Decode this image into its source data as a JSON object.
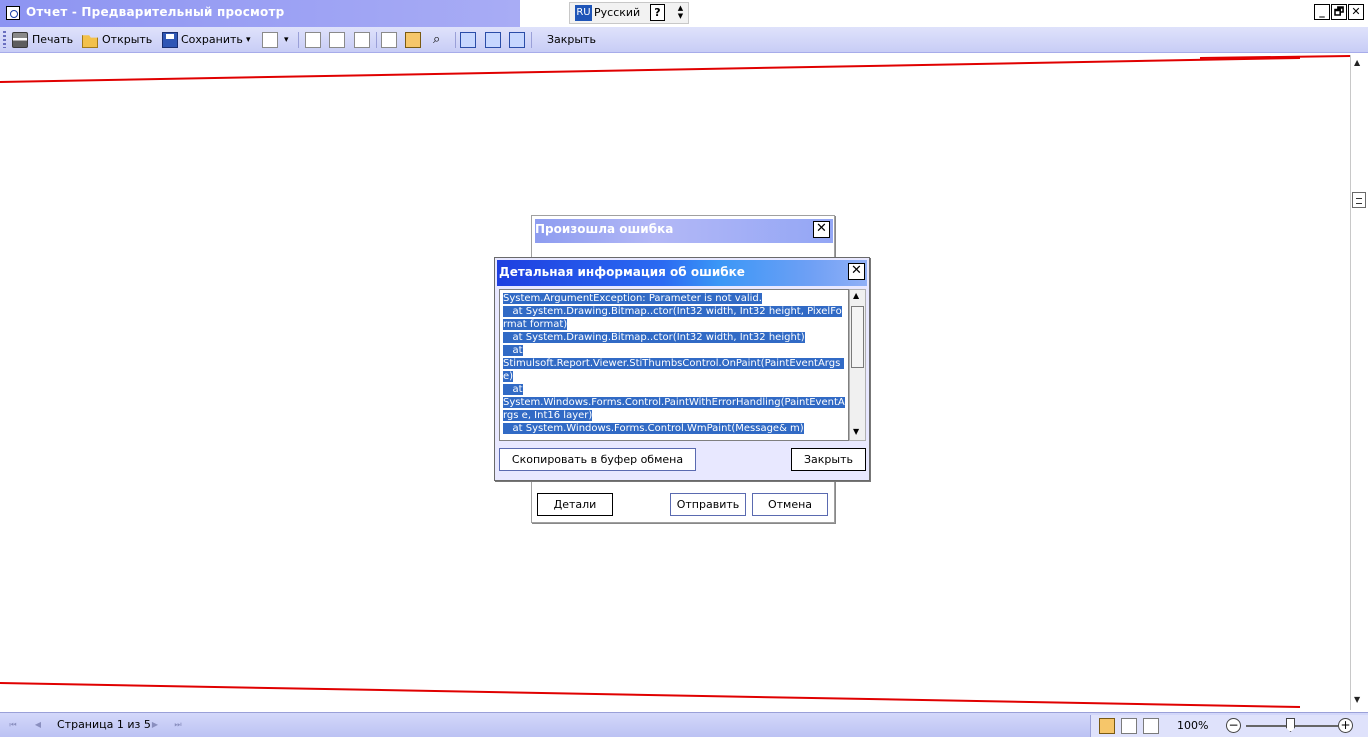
{
  "window": {
    "title": "Отчет - Предварительный просмотр",
    "language_code": "RU",
    "language_name": "Русский",
    "help_glyph": "?",
    "controls": {
      "minimize": "_",
      "restore": "🗗",
      "close": "✕"
    }
  },
  "toolbar": {
    "print_label": "Печать",
    "open_label": "Открыть",
    "save_label": "Сохранить",
    "close_label": "Закрыть",
    "dropdown_glyph": "▾"
  },
  "statusbar": {
    "page_text": "Страница 1 из 5",
    "zoom": "100%",
    "nav_first": "⏮",
    "nav_prev": "◀",
    "nav_next": "▶",
    "nav_last": "⏭"
  },
  "error_dialog": {
    "title": "Произошла ошибка",
    "close_glyph": "✕",
    "details_label": "Детали",
    "send_label": "Отправить",
    "cancel_label": "Отмена"
  },
  "details_dialog": {
    "title": "Детальная информация об ошибке",
    "close_glyph": "✕",
    "lines": [
      "System.ArgumentException: Parameter is not valid.",
      "   at System.Drawing.Bitmap..ctor(Int32 width, Int32 height, PixelFormat format)",
      "   at System.Drawing.Bitmap..ctor(Int32 width, Int32 height)",
      "   at",
      "Stimulsoft.Report.Viewer.StiThumbsControl.OnPaint(PaintEventArgs e)",
      "   at",
      "System.Windows.Forms.Control.PaintWithErrorHandling(PaintEventArgs e, Int16 layer)",
      "   at System.Windows.Forms.Control.WmPaint(Message& m)"
    ],
    "copy_label": "Скопировать в буфер обмена",
    "close_label": "Закрыть"
  },
  "colors": {
    "page_border": "#e00000",
    "selection": "#316ac5",
    "title_blue": "#1e3fe0"
  }
}
